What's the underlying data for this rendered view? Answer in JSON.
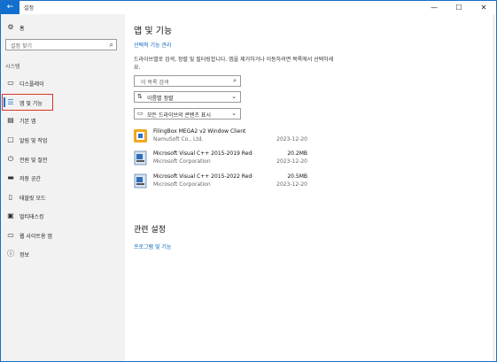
{
  "window": {
    "title": "설정",
    "back_glyph": "←",
    "minimize": "—",
    "maximize": "☐",
    "close": "✕"
  },
  "sidebar": {
    "home_label": "홈",
    "search_placeholder": "설정 찾기",
    "section_label": "시스템",
    "items": [
      {
        "label": "디스플레이",
        "icon": "display-icon",
        "glyph": "▭"
      },
      {
        "label": "앱 및 기능",
        "icon": "apps-list-icon",
        "glyph": "☰",
        "selected": true
      },
      {
        "label": "기본 앱",
        "icon": "default-apps-icon",
        "glyph": "▤"
      },
      {
        "label": "알림 및 작업",
        "icon": "notification-icon",
        "glyph": "▢"
      },
      {
        "label": "전원 및 절전",
        "icon": "power-icon",
        "glyph": "⏻"
      },
      {
        "label": "저장 공간",
        "icon": "storage-icon",
        "glyph": "▬"
      },
      {
        "label": "태블릿 모드",
        "icon": "tablet-icon",
        "glyph": "▯"
      },
      {
        "label": "멀티태스킹",
        "icon": "multitask-icon",
        "glyph": "▣"
      },
      {
        "label": "웹 사이트용 앱",
        "icon": "web-apps-icon",
        "glyph": "▭"
      },
      {
        "label": "정보",
        "icon": "info-icon",
        "glyph": "ⓘ"
      }
    ]
  },
  "main": {
    "title": "앱 및 기능",
    "optional_features_link": "선택적 기능 관리",
    "description": "드라이브별로 검색, 정렬 및 필터링합니다. 앱을 제거하거나 이동하려면 목록에서 선택하세요.",
    "list_search_placeholder": "이 목록 검색",
    "sort_value": "이름별 정렬",
    "filter_value": "모든 드라이브의 콘텐츠 표시",
    "apps": [
      {
        "name": "FilingBox MEGA2 v2 Window Client",
        "publisher": "NamuSoft Co., Ltd.",
        "size": "",
        "date": "2023-12-20",
        "icon": "filingbox-icon"
      },
      {
        "name": "Microsoft Visual C++ 2015-2019 Redistrib...",
        "publisher": "Microsoft Corporation",
        "size": "20.2MB",
        "date": "2023-12-20",
        "icon": "installer-icon"
      },
      {
        "name": "Microsoft Visual C++ 2015-2022 Redistrib...",
        "publisher": "Microsoft Corporation",
        "size": "20.5MB",
        "date": "2023-12-20",
        "icon": "installer-icon"
      }
    ],
    "related_title": "관련 설정",
    "related_link": "프로그램 및 기능"
  },
  "colors": {
    "accent": "#1170cf",
    "highlight_box": "#d9342b",
    "link": "#0a64b8"
  }
}
